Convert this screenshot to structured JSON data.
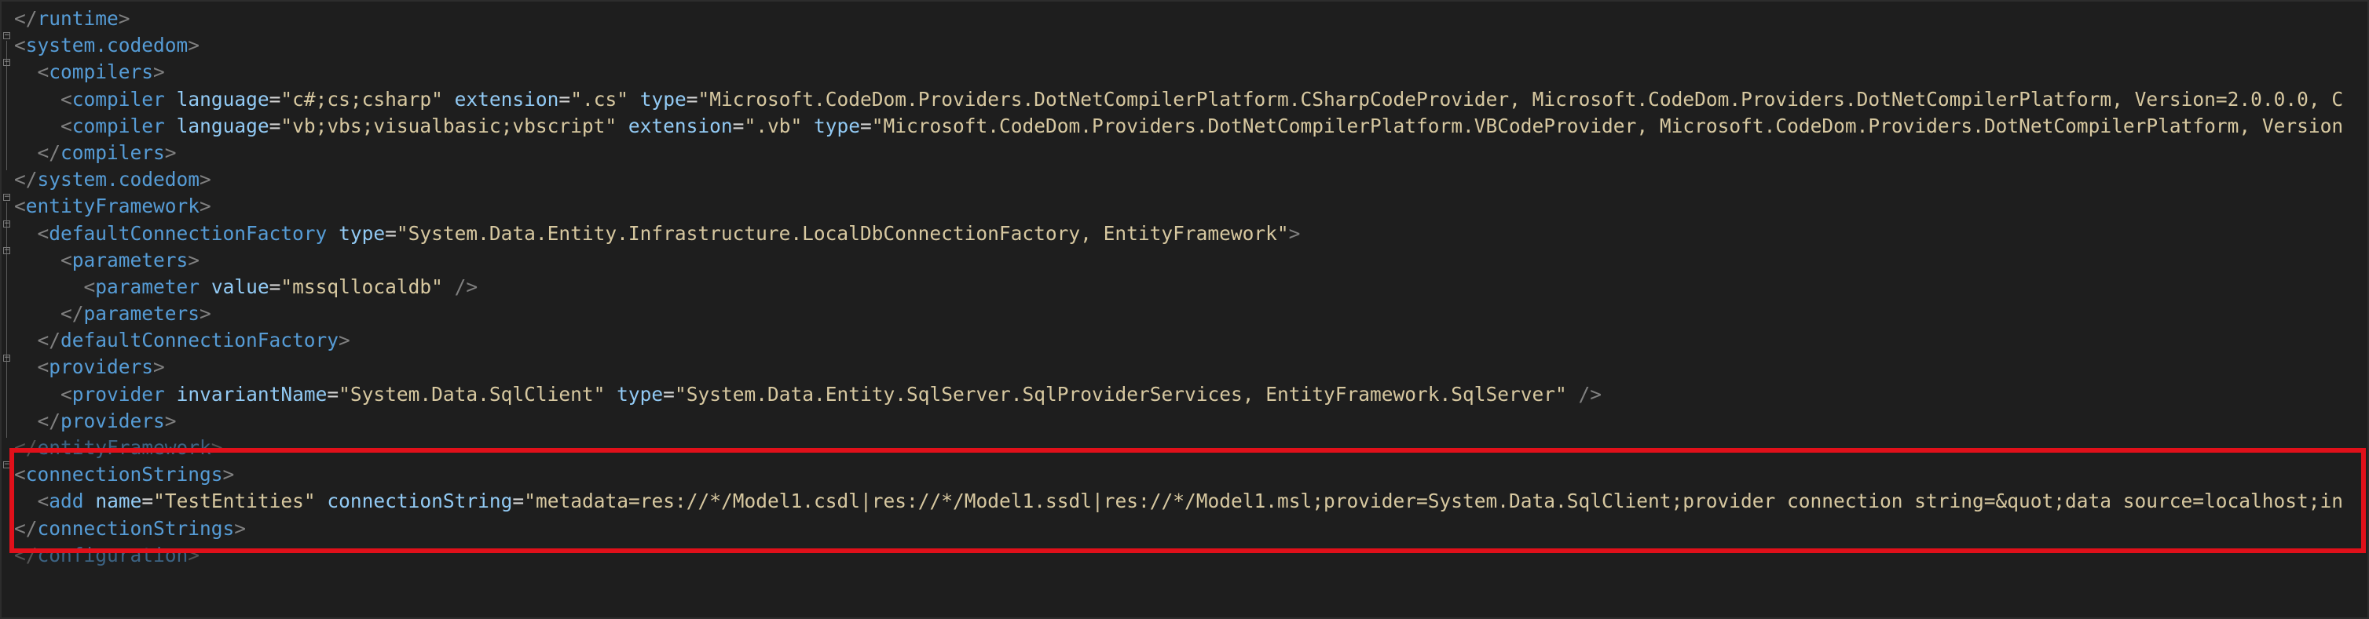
{
  "editor": {
    "lines": [
      [
        "</",
        "runtime",
        ">"
      ],
      [
        "<",
        "system.codedom",
        ">"
      ],
      [
        "<",
        "compilers",
        ">"
      ],
      [
        "<",
        "compiler",
        " ",
        "language",
        "=",
        "\"",
        "c#;cs;csharp",
        "\"",
        " ",
        "extension",
        "=",
        "\"",
        ".cs",
        "\"",
        " ",
        "type",
        "=",
        "\"",
        "Microsoft.CodeDom.Providers.DotNetCompilerPlatform.CSharpCodeProvider, Microsoft.CodeDom.Providers.DotNetCompilerPlatform, Version=2.0.0.0, C"
      ],
      [
        "<",
        "compiler",
        " ",
        "language",
        "=",
        "\"",
        "vb;vbs;visualbasic;vbscript",
        "\"",
        " ",
        "extension",
        "=",
        "\"",
        ".vb",
        "\"",
        " ",
        "type",
        "=",
        "\"",
        "Microsoft.CodeDom.Providers.DotNetCompilerPlatform.VBCodeProvider, Microsoft.CodeDom.Providers.DotNetCompilerPlatform, Version"
      ],
      [
        "</",
        "compilers",
        ">"
      ],
      [
        "</",
        "system.codedom",
        ">"
      ],
      [
        "<",
        "entityFramework",
        ">"
      ],
      [
        "<",
        "defaultConnectionFactory",
        " ",
        "type",
        "=",
        "\"",
        "System.Data.Entity.Infrastructure.LocalDbConnectionFactory, EntityFramework",
        "\"",
        ">"
      ],
      [
        "<",
        "parameters",
        ">"
      ],
      [
        "<",
        "parameter",
        " ",
        "value",
        "=",
        "\"",
        "mssqllocaldb",
        "\"",
        " />"
      ],
      [
        "</",
        "parameters",
        ">"
      ],
      [
        "</",
        "defaultConnectionFactory",
        ">"
      ],
      [
        "<",
        "providers",
        ">"
      ],
      [
        "<",
        "provider",
        " ",
        "invariantName",
        "=",
        "\"",
        "System.Data.SqlClient",
        "\"",
        " ",
        "type",
        "=",
        "\"",
        "System.Data.Entity.SqlServer.SqlProviderServices, EntityFramework.SqlServer",
        "\"",
        " />"
      ],
      [
        "</",
        "providers",
        ">"
      ],
      [
        "</",
        "entityFramework",
        ">"
      ],
      [
        "<",
        "connectionStrings",
        ">"
      ],
      [
        "<",
        "add",
        " ",
        "name",
        "=",
        "\"",
        "TestEntities",
        "\"",
        " ",
        "connectionString",
        "=",
        "\"",
        "metadata=res://*/Model1.csdl|res://*/Model1.ssdl|res://*/Model1.msl;provider=System.Data.SqlClient;provider connection string=&quot;data source=localhost;in"
      ],
      [
        "</",
        "connectionStrings",
        ">"
      ],
      [
        "</",
        "configuration",
        ">"
      ]
    ]
  },
  "highlight": {
    "color": "#e0101a",
    "label": "connectionStrings block highlighted"
  },
  "colors": {
    "background": "#1e1e1e",
    "bracket": "#808080",
    "tag": "#569cd6",
    "attribute": "#92caf4",
    "value": "#d7c8a0"
  },
  "icons": {
    "fold": "collapse-box-icon"
  }
}
